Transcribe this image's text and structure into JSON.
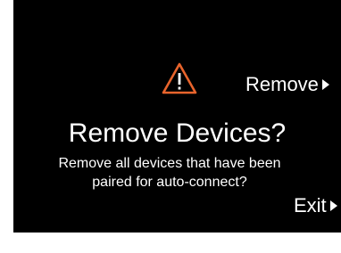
{
  "dialog": {
    "title": "Remove Devices?",
    "message": "Remove all devices that have been paired for auto-connect?",
    "warning_icon": "warning-triangle-icon",
    "warning_color": "#e8642c"
  },
  "actions": {
    "remove_label": "Remove",
    "exit_label": "Exit",
    "arrow_icon": "play-arrow-icon"
  },
  "colors": {
    "background": "#000000",
    "text": "#ffffff",
    "accent": "#e8642c"
  }
}
